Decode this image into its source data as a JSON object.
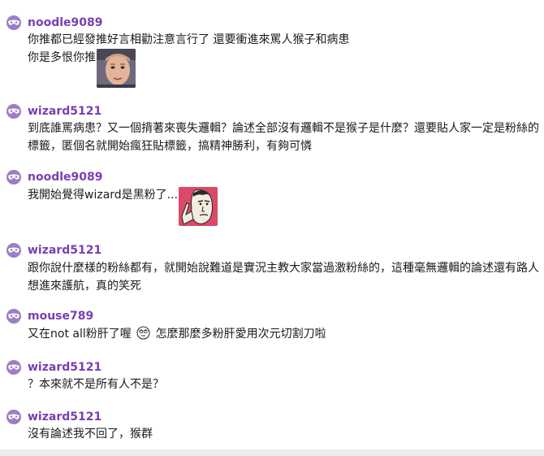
{
  "comments": [
    {
      "username": "noodle9089",
      "lines": [
        "你推都已經發推好言相勸注意言行了 還要衝進來罵人猴子和病患",
        "你是多恨你推"
      ],
      "image": "reaction-face-image"
    },
    {
      "username": "wizard5121",
      "lines": [
        "到底誰罵病患？又一個揹著來喪失邏輯？論述全部沒有邏輯不是猴子是什麼？還要貼人家一定是粉絲的",
        "標籤，匿個名就開始瘋狂貼標籤，搞精神勝利，有夠可憐"
      ]
    },
    {
      "username": "noodle9089",
      "lines": [
        "我開始覺得wizard是黑粉了..."
      ],
      "image": "pointing-face-image"
    },
    {
      "username": "wizard5121",
      "lines": [
        "跟你說什麼樣的粉絲都有，就開始說難道是實況主教大家當過激粉絲的，這種毫無邏輯的論述還有路人",
        "想進來護航，真的笑死"
      ]
    },
    {
      "username": "mouse789",
      "line_a": "又在not all粉肝了喔",
      "emote": "eye-roll-emoji",
      "line_b": "怎麼那麼多粉肝愛用次元切割刀啦"
    },
    {
      "username": "wizard5121",
      "lines": [
        "？本來就不是所有人不是？"
      ]
    },
    {
      "username": "wizard5121",
      "lines": [
        "沒有論述我不回了，猴群"
      ]
    }
  ],
  "colors": {
    "username": "#7a3fb0",
    "avatar": "#9b7ec4",
    "text": "#1a1a1a"
  }
}
